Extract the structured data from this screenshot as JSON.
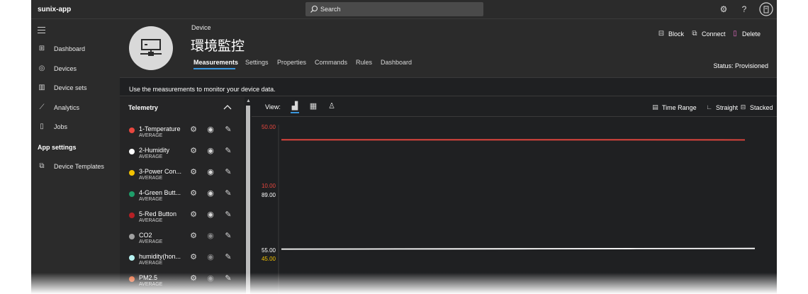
{
  "app": {
    "name": "sunix-app"
  },
  "search": {
    "placeholder": "Search"
  },
  "topbar": {
    "icons": [
      "gear-icon",
      "help-icon",
      "account-icon"
    ]
  },
  "sidebar": {
    "items": [
      {
        "label": "Dashboard",
        "icon": "dashboard-icon"
      },
      {
        "label": "Devices",
        "icon": "devices-icon"
      },
      {
        "label": "Device sets",
        "icon": "device-sets-icon"
      },
      {
        "label": "Analytics",
        "icon": "analytics-icon"
      },
      {
        "label": "Jobs",
        "icon": "jobs-icon"
      }
    ],
    "section": "App settings",
    "settings_items": [
      {
        "label": "Device Templates",
        "icon": "device-templates-icon"
      }
    ]
  },
  "device": {
    "kind": "Device",
    "title": "環境監控",
    "status": "Status: Provisioned"
  },
  "tabs": [
    "Measurements",
    "Settings",
    "Properties",
    "Commands",
    "Rules",
    "Dashboard"
  ],
  "actions": {
    "block": "Block",
    "connect": "Connect",
    "delete": "Delete"
  },
  "info": "Use the measurements to monitor your device data.",
  "telemetry": {
    "title": "Telemetry",
    "items": [
      {
        "name": "1-Temperature",
        "agg": "AVERAGE",
        "color": "#e8473f"
      },
      {
        "name": "2-Humidity",
        "agg": "AVERAGE",
        "color": "#ffffff"
      },
      {
        "name": "3-Power Con...",
        "agg": "AVERAGE",
        "color": "#f2c200"
      },
      {
        "name": "4-Green Butt...",
        "agg": "AVERAGE",
        "color": "#1e9e6a"
      },
      {
        "name": "5-Red Button",
        "agg": "AVERAGE",
        "color": "#b52025"
      },
      {
        "name": "CO2",
        "agg": "AVERAGE",
        "color": "#a0a0a0"
      },
      {
        "name": "humidity(hon...",
        "agg": "AVERAGE",
        "color": "#b6f2f2"
      },
      {
        "name": "PM2.5",
        "agg": "AVERAGE",
        "color": "#e86a3a"
      }
    ]
  },
  "chart_toolbar": {
    "view_label": "View:",
    "time_range": "Time Range",
    "straight": "Straight",
    "stacked": "Stacked"
  },
  "chart_data": {
    "type": "line",
    "axes": [
      {
        "color": "#e8473f",
        "ticks": [
          "50.00",
          "10.00"
        ],
        "range": [
          10,
          50
        ]
      },
      {
        "color": "#ffffff",
        "ticks": [
          "89.00",
          "55.00"
        ],
        "range": [
          55,
          89
        ]
      },
      {
        "color": "#f2c200",
        "ticks": [
          "45.00"
        ]
      }
    ],
    "series": [
      {
        "name": "1-Temperature",
        "color": "#e8473f",
        "values": [
          41.2,
          41.2,
          41.2,
          41.2,
          41.1
        ]
      },
      {
        "name": "2-Humidity",
        "color": "#ffffff",
        "values": [
          55.6,
          55.7,
          55.8,
          55.9,
          56.0
        ]
      }
    ]
  }
}
